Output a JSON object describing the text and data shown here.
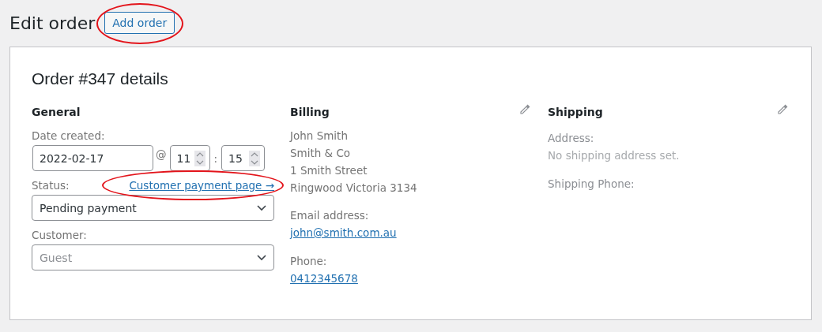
{
  "page_title": "Edit order",
  "add_button": {
    "label": "Add order",
    "circled": true
  },
  "panel": {
    "title": "Order #347 details",
    "general": {
      "heading": "General",
      "date_label": "Date created:",
      "date": "2022-02-17",
      "at": "@",
      "hour": "11",
      "separator": ":",
      "minute": "15",
      "status_label": "Status:",
      "payment_link": {
        "label": "Customer payment page →",
        "circled": true
      },
      "status": "Pending payment",
      "customer_label": "Customer:",
      "customer_placeholder": "Guest"
    },
    "billing": {
      "heading": "Billing",
      "address_lines": [
        "John Smith",
        "Smith & Co",
        "1 Smith Street",
        "Ringwood Victoria 3134"
      ],
      "fields": [
        {
          "label": "Email address:",
          "value": "john@smith.com.au",
          "kind": "link"
        },
        {
          "label": "Phone:",
          "value": "0412345678",
          "kind": "link"
        }
      ]
    },
    "shipping": {
      "heading": "Shipping",
      "fields": [
        {
          "label": "Address:",
          "placeholder": "No shipping address set."
        },
        {
          "label": "Shipping Phone:"
        }
      ]
    }
  }
}
